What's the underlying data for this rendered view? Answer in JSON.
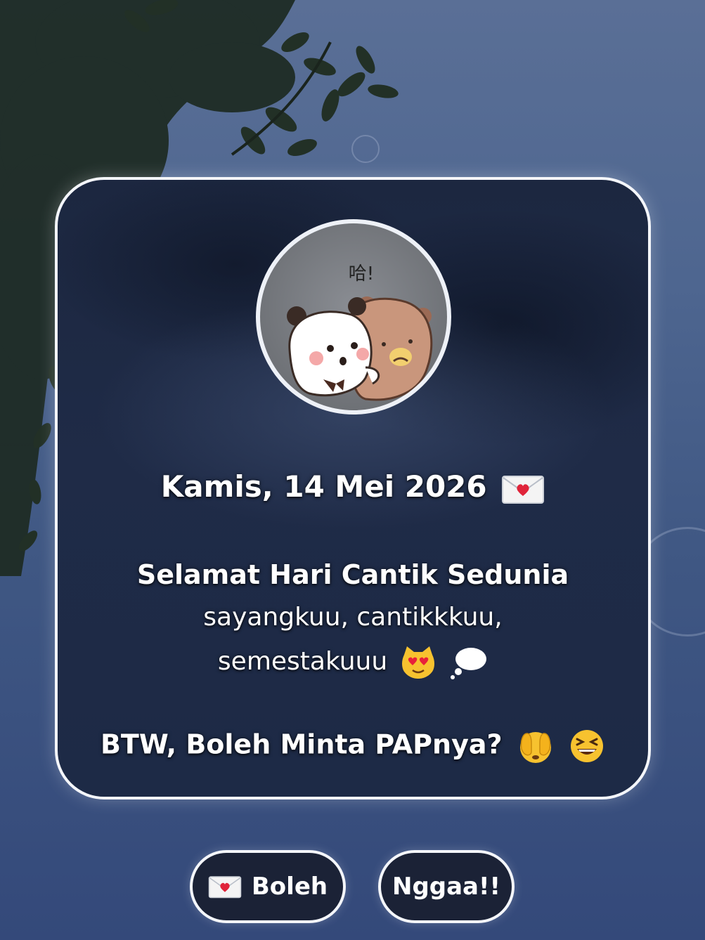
{
  "card": {
    "avatar_caption": "哈!",
    "date_line": "Kamis, 14 Mei 2026",
    "greeting_title": "Selamat Hari Cantik Sedunia",
    "greeting_line1": "sayangkuu, cantikkkuu,",
    "greeting_line2": "semestakuuu",
    "question": "BTW, Boleh Minta PAPnya?"
  },
  "buttons": {
    "yes_label": "Boleh",
    "no_label": "Nggaa!!"
  },
  "icons": {
    "date_emoji": "love-letter-icon",
    "greeting_emojis": [
      "heart-eyes-cat-icon",
      "thought-bubble-icon"
    ],
    "question_emojis": [
      "peeking-face-icon",
      "grinning-squinting-face-icon"
    ],
    "yes_button_icon": "love-letter-icon"
  },
  "colors": {
    "card_border": "#f4f6fb",
    "card_background": "#1f2b47",
    "sky": "#4e6690",
    "button_background": "#1b2236"
  }
}
